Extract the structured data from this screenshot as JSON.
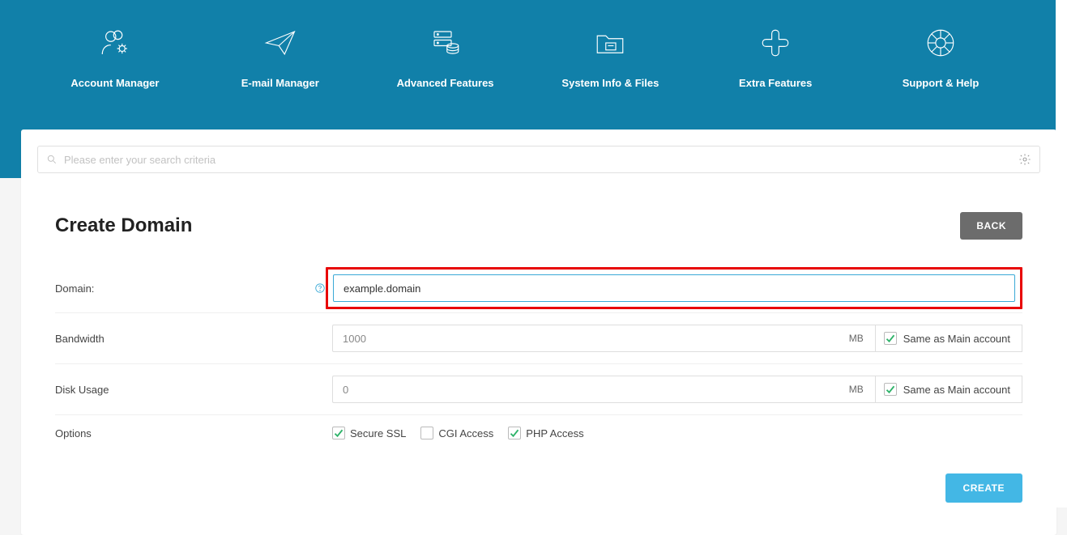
{
  "nav": [
    {
      "label": "Account Manager",
      "name": "nav-account-manager",
      "icon": "users-gear"
    },
    {
      "label": "E-mail Manager",
      "name": "nav-email-manager",
      "icon": "paper-plane"
    },
    {
      "label": "Advanced Features",
      "name": "nav-advanced-features",
      "icon": "server-db"
    },
    {
      "label": "System Info & Files",
      "name": "nav-system-info",
      "icon": "folder-file"
    },
    {
      "label": "Extra Features",
      "name": "nav-extra-features",
      "icon": "plus"
    },
    {
      "label": "Support & Help",
      "name": "nav-support-help",
      "icon": "lifebuoy"
    }
  ],
  "search": {
    "placeholder": "Please enter your search criteria"
  },
  "page": {
    "title": "Create Domain"
  },
  "buttons": {
    "back": "BACK",
    "create": "CREATE"
  },
  "form": {
    "domain": {
      "label": "Domain:",
      "value": "example.domain"
    },
    "bandwidth": {
      "label": "Bandwidth",
      "value": "1000",
      "unit": "MB",
      "same_label": "Same as Main account",
      "same_checked": true
    },
    "disk": {
      "label": "Disk Usage",
      "value": "0",
      "unit": "MB",
      "same_label": "Same as Main account",
      "same_checked": true
    },
    "options": {
      "label": "Options",
      "items": [
        {
          "label": "Secure SSL",
          "checked": true,
          "name": "opt-secure-ssl"
        },
        {
          "label": "CGI Access",
          "checked": false,
          "name": "opt-cgi-access"
        },
        {
          "label": "PHP Access",
          "checked": true,
          "name": "opt-php-access"
        }
      ]
    }
  }
}
